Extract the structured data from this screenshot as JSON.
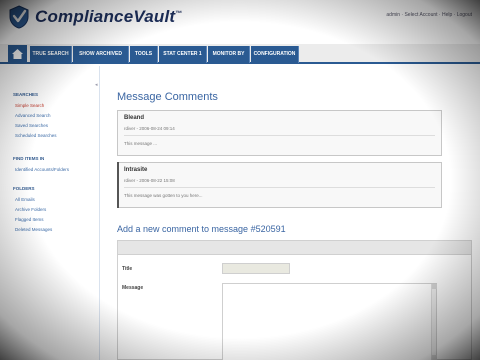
{
  "app": {
    "name": "ComplianceVault",
    "trademark": "™",
    "user_bar": "admin · Select Account · Help · Logout"
  },
  "tabs": [
    {
      "label": "TRUE SEARCH"
    },
    {
      "label": "SHOW ARCHIVED"
    },
    {
      "label": "TOOLS"
    },
    {
      "label": "STAT CENTER 1"
    },
    {
      "label": "MONITOR BY"
    },
    {
      "label": "CONFIGURATION"
    }
  ],
  "sidebar": {
    "sections": [
      {
        "heading": "SEARCHES",
        "items": [
          {
            "label": "Simple Search",
            "active": true
          },
          {
            "label": "Advanced Search",
            "active": false
          },
          {
            "label": "Saved Searches",
            "active": false
          },
          {
            "label": "Scheduled Searches",
            "active": false
          }
        ]
      },
      {
        "heading": "FIND ITEMS IN",
        "items": [
          {
            "label": "Identified Accounts/Folders",
            "active": false
          }
        ]
      },
      {
        "heading": "FOLDERS",
        "items": [
          {
            "label": "All Emails",
            "active": false
          },
          {
            "label": "Archive Folders",
            "active": false
          },
          {
            "label": "Flagged Items",
            "active": false
          },
          {
            "label": "Deleted Messages",
            "active": false
          }
        ]
      }
    ]
  },
  "main": {
    "title": "Message Comments",
    "comments": [
      {
        "author": "Bleand",
        "meta": "rdiver - 2006-08-24 09:14",
        "body": "This message ..."
      },
      {
        "author": "Intrasite",
        "meta": "rdiver - 2006-08-22 15:08",
        "body": "This message was gotten to you here..."
      }
    ],
    "add_title": "Add a new comment to message #520591",
    "form": {
      "title_label": "Title",
      "title_value": "",
      "message_label": "Message",
      "message_value": ""
    }
  },
  "colors": {
    "tab": "#2a5a92",
    "link": "#3b6aa6",
    "active_link": "#c0392b",
    "heading": "#3b66a3"
  }
}
